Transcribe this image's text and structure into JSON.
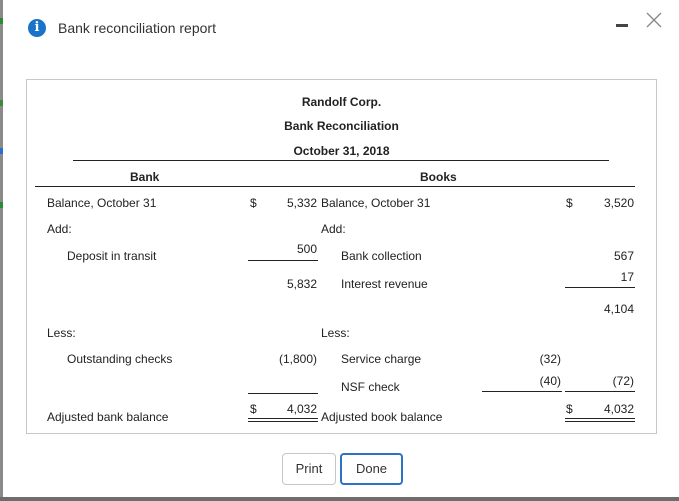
{
  "dialog": {
    "title": "Bank reconciliation report",
    "info_icon": "i"
  },
  "colors": {
    "info_icon": "#1a73c9",
    "done_border": "#2e72c2",
    "panel_border": "#c8c8c8"
  },
  "report": {
    "company": "Randolf Corp.",
    "title": "Bank Reconciliation",
    "date": "October 31, 2018",
    "bank_header": "Bank",
    "books_header": "Books",
    "bank": {
      "balance_label": "Balance, October 31",
      "balance_currency": "$",
      "balance_value": "5,332",
      "add_label": "Add:",
      "deposit_label": "Deposit in transit",
      "deposit_value": "500",
      "subtotal_value": "5,832",
      "less_label": "Less:",
      "outstanding_label": "Outstanding checks",
      "outstanding_value": "(1,800)",
      "adjusted_label": "Adjusted bank balance",
      "adjusted_currency": "$",
      "adjusted_value": "4,032"
    },
    "books": {
      "balance_label": "Balance, October 31",
      "balance_currency": "$",
      "balance_value": "3,520",
      "add_label": "Add:",
      "collection_label": "Bank collection",
      "collection_value": "567",
      "interest_label": "Interest revenue",
      "interest_value": "17",
      "subtotal_value": "4,104",
      "less_label": "Less:",
      "service_label": "Service charge",
      "service_value": "(32)",
      "nsf_label": "NSF check",
      "nsf_value": "(40)",
      "deductions_total": "(72)",
      "adjusted_label": "Adjusted book balance",
      "adjusted_currency": "$",
      "adjusted_value": "4,032"
    }
  },
  "buttons": {
    "print": "Print",
    "done": "Done"
  }
}
